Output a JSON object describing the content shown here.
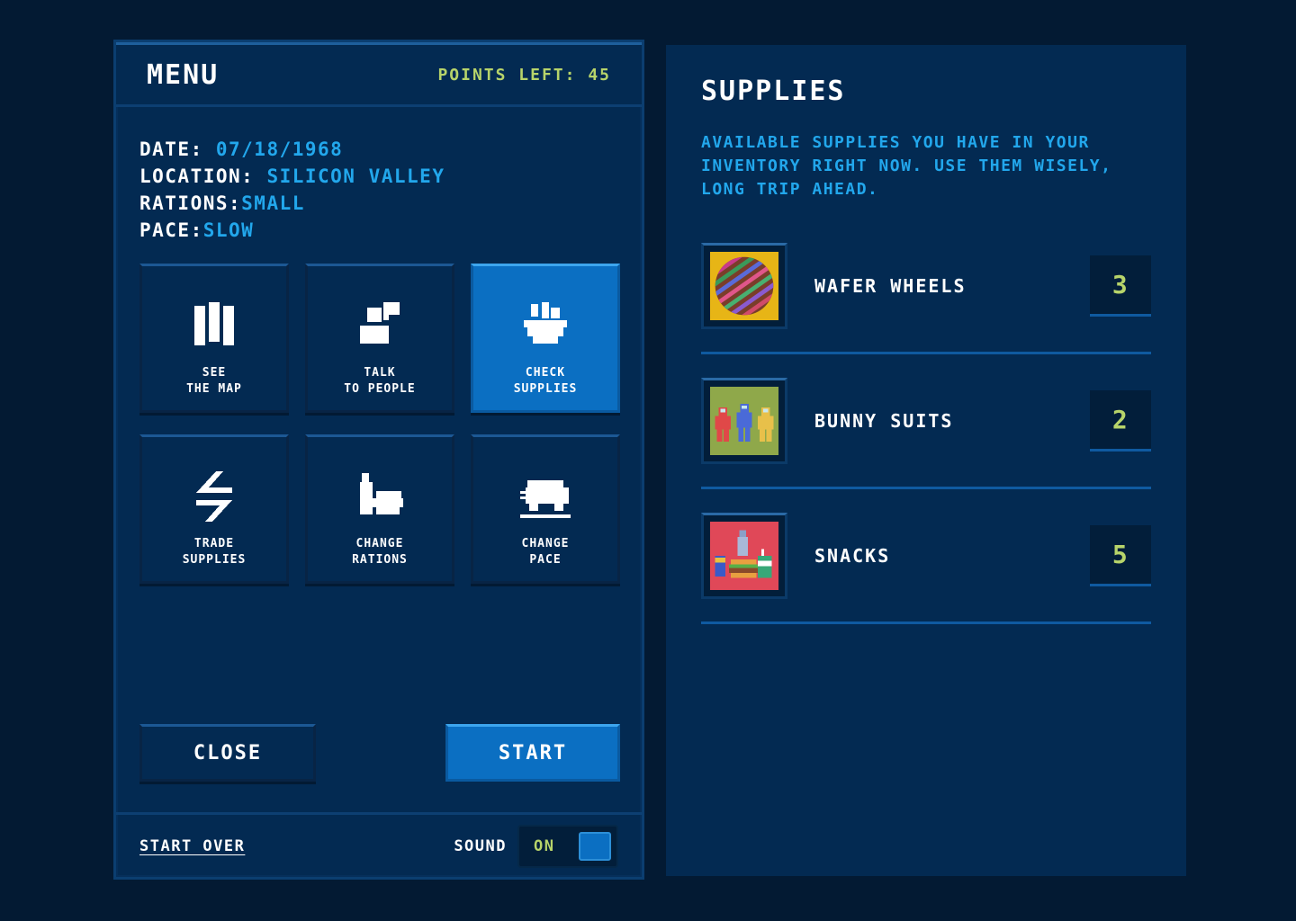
{
  "menu": {
    "title": "MENU",
    "points_left": "POINTS LEFT: 45",
    "status": {
      "date_label": "DATE:",
      "date_value": "07/18/1968",
      "location_label": "LOCATION:",
      "location_value": "SILICON VALLEY",
      "rations_label": "RATIONS:",
      "rations_value": "SMALL",
      "pace_label": "PACE:",
      "pace_value": "SLOW"
    },
    "actions": [
      {
        "label": "SEE\nTHE MAP",
        "icon": "map-icon",
        "active": false
      },
      {
        "label": "TALK\nTO PEOPLE",
        "icon": "talk-icon",
        "active": false
      },
      {
        "label": "CHECK\nSUPPLIES",
        "icon": "supplies-bowl-icon",
        "active": true
      },
      {
        "label": "TRADE\nSUPPLIES",
        "icon": "trade-arrows-icon",
        "active": false
      },
      {
        "label": "CHANGE\nRATIONS",
        "icon": "rations-icon",
        "active": false
      },
      {
        "label": "CHANGE\nPACE",
        "icon": "van-icon",
        "active": false
      }
    ],
    "close_label": "CLOSE",
    "start_label": "START",
    "start_over_label": "START OVER",
    "sound_label": "SOUND",
    "sound_state": "ON"
  },
  "supplies": {
    "title": "SUPPLIES",
    "description": "AVAILABLE SUPPLIES YOU HAVE IN YOUR INVENTORY RIGHT NOW. USE THEM WISELY, LONG TRIP AHEAD.",
    "items": [
      {
        "name": "WAFER WHEELS",
        "quantity": "3",
        "icon": "wafer-wheel-icon"
      },
      {
        "name": "BUNNY SUITS",
        "quantity": "2",
        "icon": "bunny-suits-icon"
      },
      {
        "name": "SNACKS",
        "quantity": "5",
        "icon": "snacks-icon"
      }
    ]
  },
  "colors": {
    "background": "#031a33",
    "panel": "#032a52",
    "accent_blue": "#22a7ec",
    "active_blue": "#0b6fc2",
    "points_green": "#b7d46a"
  }
}
